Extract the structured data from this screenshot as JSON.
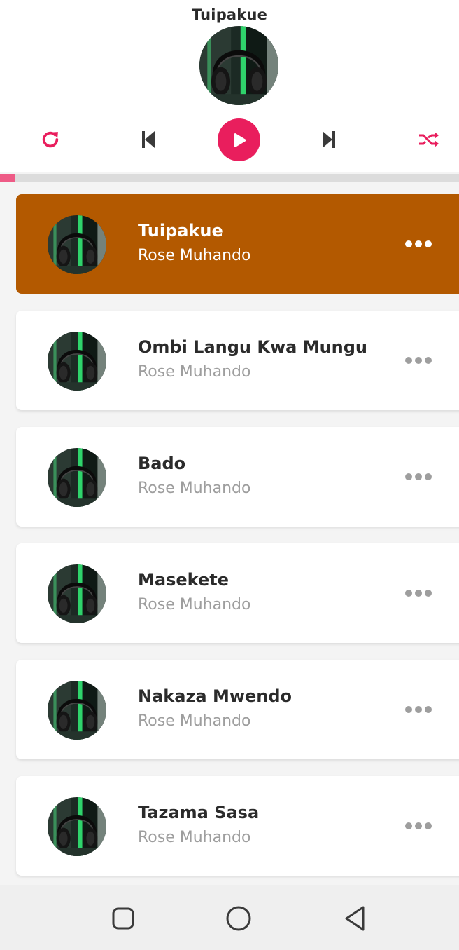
{
  "player": {
    "now_playing_title": "Tuipakue",
    "progress": 0.034,
    "accent_color": "#e91e5d",
    "controls": [
      {
        "name": "repeat-icon"
      },
      {
        "name": "previous-icon"
      },
      {
        "name": "play-icon"
      },
      {
        "name": "next-icon"
      },
      {
        "name": "shuffle-icon"
      }
    ]
  },
  "songs": [
    {
      "title": "Tuipakue",
      "artist": "Rose Muhando",
      "active": true
    },
    {
      "title": "Ombi Langu Kwa Mungu",
      "artist": "Rose Muhando",
      "active": false
    },
    {
      "title": "Bado",
      "artist": "Rose Muhando",
      "active": false
    },
    {
      "title": "Masekete",
      "artist": "Rose Muhando",
      "active": false
    },
    {
      "title": "Nakaza Mwendo",
      "artist": "Rose Muhando",
      "active": false
    },
    {
      "title": "Tazama Sasa",
      "artist": "Rose Muhando",
      "active": false
    }
  ],
  "active_color": "#b35900",
  "navbar": {
    "buttons": [
      {
        "name": "recent-apps-icon"
      },
      {
        "name": "home-icon"
      },
      {
        "name": "back-icon"
      }
    ]
  }
}
